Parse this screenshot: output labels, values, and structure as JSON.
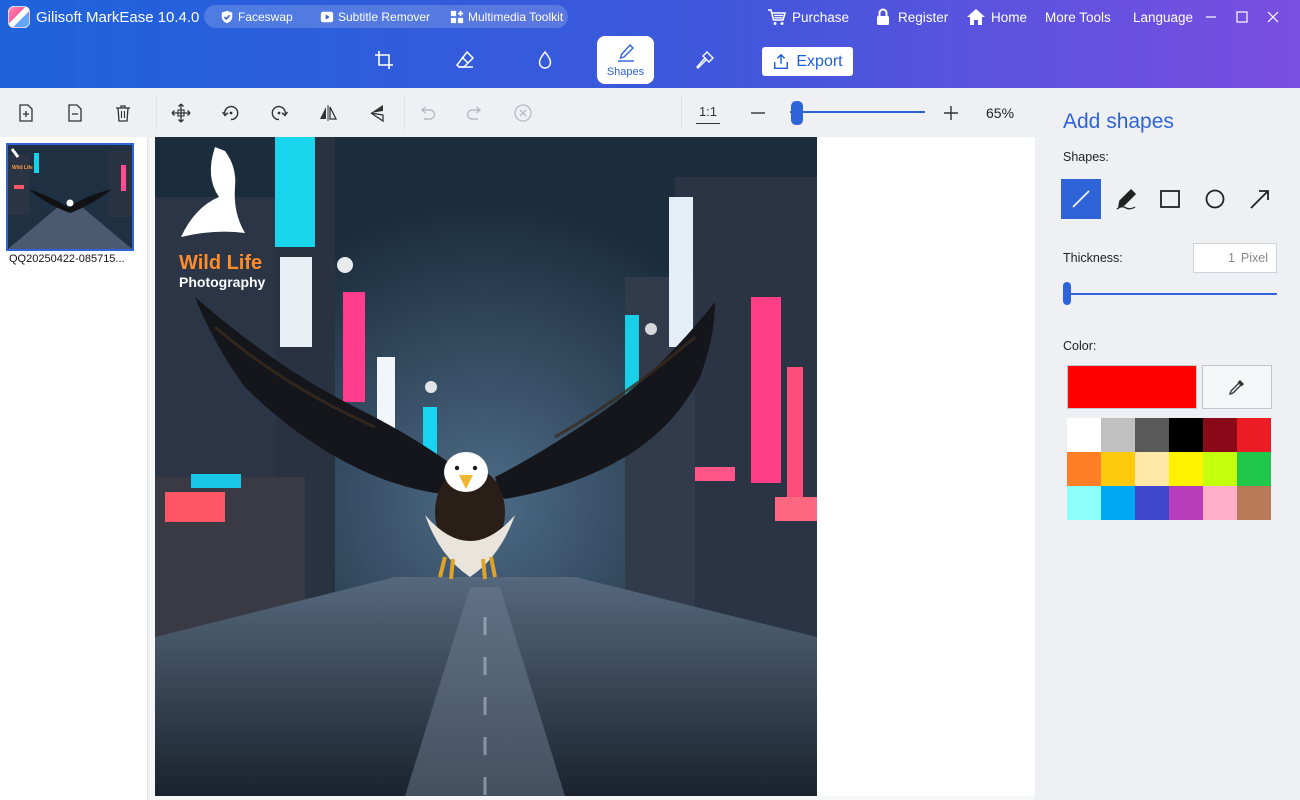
{
  "app": {
    "title": "Gilisoft MarkEase 10.4.0",
    "logo_icon": "markease-logo-icon"
  },
  "tools_menu": [
    {
      "label": "Faceswap",
      "icon": "shield-check-icon"
    },
    {
      "label": "Subtitle Remover",
      "icon": "play-box-icon"
    },
    {
      "label": "Multimedia Toolkit",
      "icon": "grid-plus-icon"
    }
  ],
  "top_links": [
    {
      "label": "Purchase",
      "icon": "cart-icon"
    },
    {
      "label": "Register",
      "icon": "lock-icon"
    },
    {
      "label": "Home",
      "icon": "home-icon"
    },
    {
      "label": "More Tools",
      "icon": ""
    },
    {
      "label": "Language",
      "icon": ""
    }
  ],
  "modes": [
    {
      "label": "",
      "icon": "crop-icon"
    },
    {
      "label": "",
      "icon": "eraser-icon"
    },
    {
      "label": "",
      "icon": "drop-icon"
    },
    {
      "label": "Shapes",
      "icon": "pen-shapes-icon",
      "active": true
    },
    {
      "label": "",
      "icon": "magic-wand-icon"
    }
  ],
  "export_label": "Export",
  "toolbar": {
    "ratio_label": "1:1",
    "zoom_value": "65%",
    "zoom_fraction": 0.05
  },
  "file": {
    "name": "QQ20250422-085715..."
  },
  "panel": {
    "title": "Add shapes",
    "shapes_label": "Shapes:",
    "shapes": [
      "line-icon",
      "pen-icon",
      "rectangle-icon",
      "circle-icon",
      "arrow-icon"
    ],
    "selected_shape": "line-icon",
    "thickness_label": "Thickness:",
    "thickness_value": "1",
    "thickness_unit": "Pixel",
    "color_label": "Color:",
    "current_color": "#ff0000",
    "palette": [
      "#ffffff",
      "#c0c0c0",
      "#595959",
      "#000000",
      "#8b0a1a",
      "#ec1c24",
      "#ff7f27",
      "#ffc90e",
      "#ffe8a8",
      "#fff200",
      "#c4ff0e",
      "#1fc74a",
      "#8cfffb",
      "#00a8f3",
      "#3f48cc",
      "#b83dba",
      "#ffaec8",
      "#b97a57"
    ]
  },
  "photo_overlay": {
    "line1": "Wild Life",
    "line2": "Photography"
  }
}
